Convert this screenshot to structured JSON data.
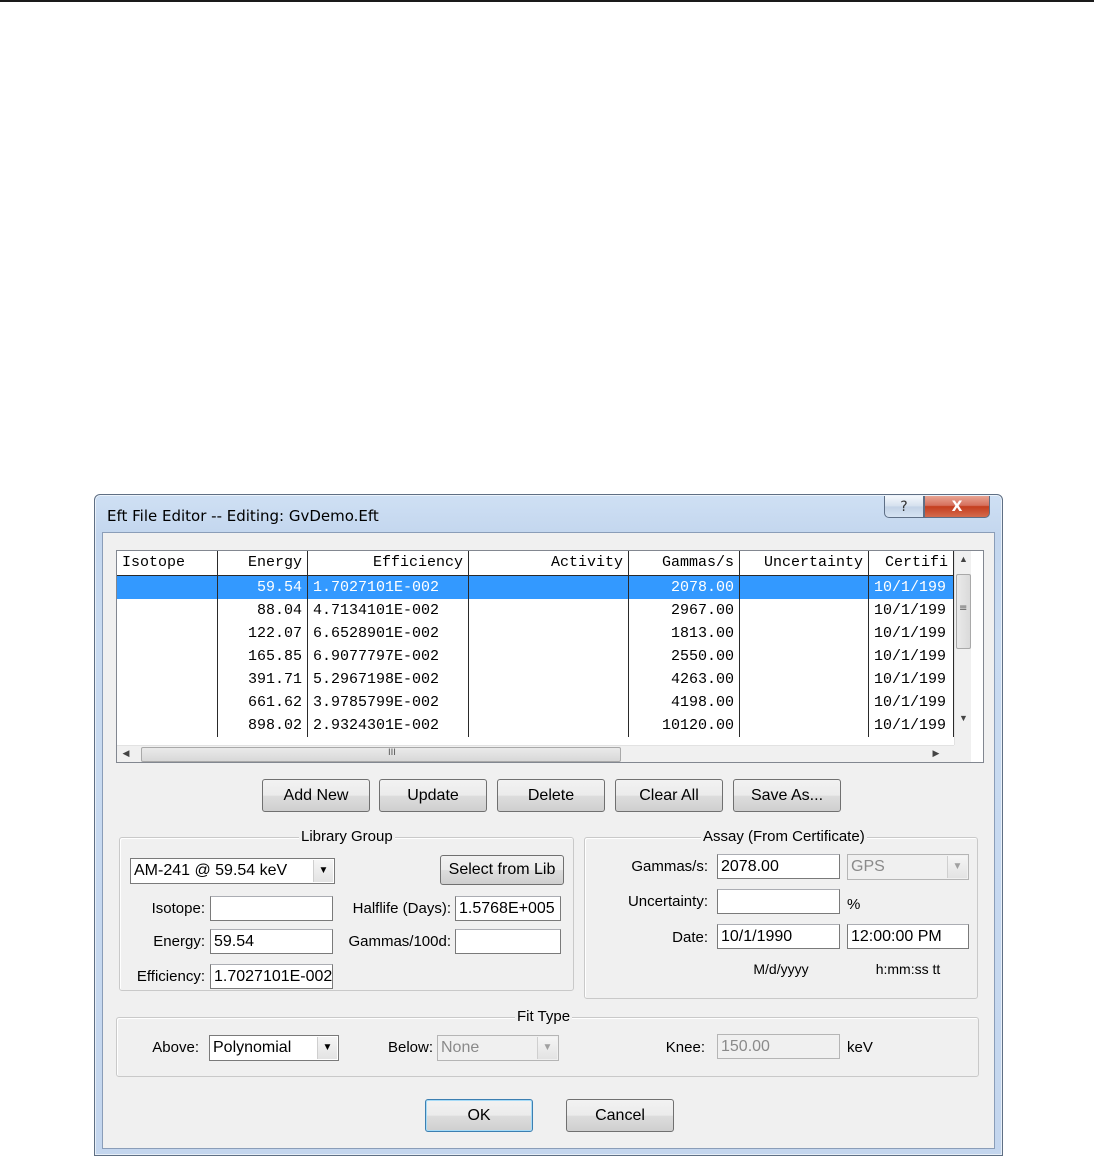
{
  "window": {
    "title": "Eft File Editor -- Editing: GvDemo.Eft",
    "help_glyph": "?",
    "close_glyph": "X"
  },
  "table": {
    "columns": [
      "Isotope",
      "Energy",
      "Efficiency",
      "Activity",
      "Gammas/s",
      "Uncertainty",
      "Certifi"
    ],
    "rows": [
      {
        "isotope": "",
        "energy": "59.54",
        "efficiency": "1.7027101E-002",
        "activity": "",
        "gammas": "2078.00",
        "uncertainty": "",
        "cert": "10/1/199"
      },
      {
        "isotope": "",
        "energy": "88.04",
        "efficiency": "4.7134101E-002",
        "activity": "",
        "gammas": "2967.00",
        "uncertainty": "",
        "cert": "10/1/199"
      },
      {
        "isotope": "",
        "energy": "122.07",
        "efficiency": "6.6528901E-002",
        "activity": "",
        "gammas": "1813.00",
        "uncertainty": "",
        "cert": "10/1/199"
      },
      {
        "isotope": "",
        "energy": "165.85",
        "efficiency": "6.9077797E-002",
        "activity": "",
        "gammas": "2550.00",
        "uncertainty": "",
        "cert": "10/1/199"
      },
      {
        "isotope": "",
        "energy": "391.71",
        "efficiency": "5.2967198E-002",
        "activity": "",
        "gammas": "4263.00",
        "uncertainty": "",
        "cert": "10/1/199"
      },
      {
        "isotope": "",
        "energy": "661.62",
        "efficiency": "3.9785799E-002",
        "activity": "",
        "gammas": "4198.00",
        "uncertainty": "",
        "cert": "10/1/199"
      },
      {
        "isotope": "",
        "energy": "898.02",
        "efficiency": "2.9324301E-002",
        "activity": "",
        "gammas": "10120.00",
        "uncertainty": "",
        "cert": "10/1/199"
      }
    ],
    "selected_row": 0
  },
  "actions": {
    "add_new": "Add New",
    "update": "Update",
    "delete": "Delete",
    "clear_all": "Clear All",
    "save_as": "Save As..."
  },
  "library": {
    "legend": "Library Group",
    "selected": "AM-241 @ 59.54 keV",
    "select_from_lib": "Select from Lib",
    "isotope_label": "Isotope:",
    "isotope_value": "",
    "energy_label": "Energy:",
    "energy_value": "59.54",
    "efficiency_label": "Efficiency:",
    "efficiency_value": "1.7027101E-002",
    "halflife_label": "Halflife (Days):",
    "halflife_value": "1.5768E+005",
    "gammas100d_label": "Gammas/100d:",
    "gammas100d_value": ""
  },
  "assay": {
    "legend": "Assay (From Certificate)",
    "gammas_label": "Gammas/s:",
    "gammas_value": "2078.00",
    "unit_value": "GPS",
    "uncertainty_label": "Uncertainty:",
    "uncertainty_value": "",
    "percent": "%",
    "date_label": "Date:",
    "date_value": "10/1/1990",
    "time_value": "12:00:00 PM",
    "date_format": "M/d/yyyy",
    "time_format": "h:mm:ss tt"
  },
  "fit": {
    "legend": "Fit Type",
    "above_label": "Above:",
    "above_value": "Polynomial",
    "below_label": "Below:",
    "below_value": "None",
    "knee_label": "Knee:",
    "knee_value": "150.00",
    "knee_unit": "keV"
  },
  "footer": {
    "ok": "OK",
    "cancel": "Cancel"
  },
  "icons": {
    "dropdown": "▼",
    "scroll_up": "▲",
    "scroll_down": "▼",
    "scroll_left": "◀",
    "scroll_right": "▶",
    "grip": "≡",
    "hgrip": "III"
  },
  "colors": {
    "selection": "#3399ff",
    "close_button": "#c43d1e",
    "window_frame": "#c4d6ee"
  }
}
